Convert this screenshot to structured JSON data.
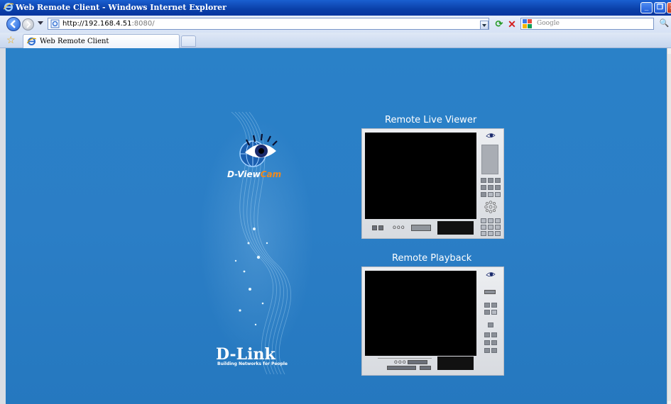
{
  "window": {
    "title": "Web Remote Client - Windows Internet Explorer",
    "minimize_label": "_",
    "maximize_label": "❐",
    "close_label": "✕"
  },
  "address_bar": {
    "url_host": "http://192.168.4.51",
    "url_rest": ":8080/",
    "search_placeholder": "Google",
    "search_icon": "🔍",
    "refresh_label": "⟳",
    "stop_label": "✕"
  },
  "tabs": [
    {
      "label": "Web Remote Client",
      "active": true
    }
  ],
  "favorites_icon": "☆",
  "page": {
    "brand_product_prefix": "D-View",
    "brand_product_suffix": "Cam",
    "brand_company": "D-Link",
    "brand_tagline": "Building Networks for People",
    "live_viewer": {
      "title": "Remote Live Viewer",
      "bottom_dots": "ooo"
    },
    "playback": {
      "title": "Remote Playback",
      "bottom_dots": "ooo"
    }
  },
  "colors": {
    "page_background": "#2a81c8",
    "titlebar": "#0a3fa8",
    "brand_orange": "#f08a1c"
  }
}
